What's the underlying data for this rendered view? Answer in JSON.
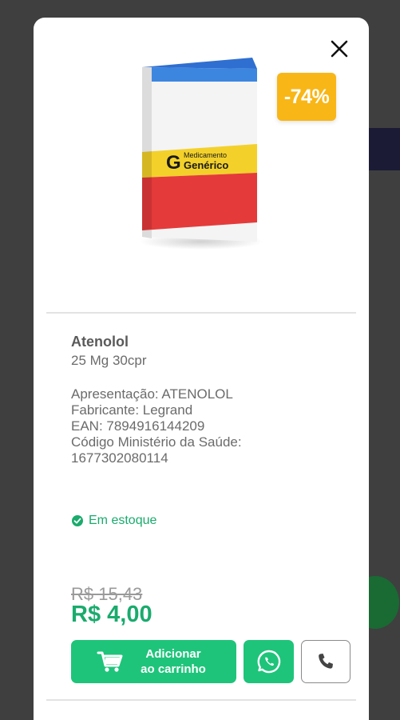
{
  "modal": {
    "discount": "-74%",
    "box_label_line1": "Medicamento",
    "box_label_line2": "Genérico",
    "box_label_letter": "G"
  },
  "product": {
    "name": "Atenolol",
    "dose": "25 Mg 30cpr",
    "details": {
      "presentation": "Apresentação: ATENOLOL",
      "manufacturer": "Fabricante: Legrand",
      "ean": "EAN: 7894916144209",
      "ministry_code_label": "Código Ministério da Saúde:",
      "ministry_code_value": "1677302080114"
    },
    "stock_status": "Em estoque",
    "old_price": "R$ 15,43",
    "new_price": "R$ 4,00"
  },
  "actions": {
    "add_to_cart_line1": "Adicionar",
    "add_to_cart_line2": "ao carrinho"
  },
  "colors": {
    "accent_green": "#1ec47a",
    "stock_green": "#1aab6d",
    "badge_yellow": "#f8b617"
  }
}
